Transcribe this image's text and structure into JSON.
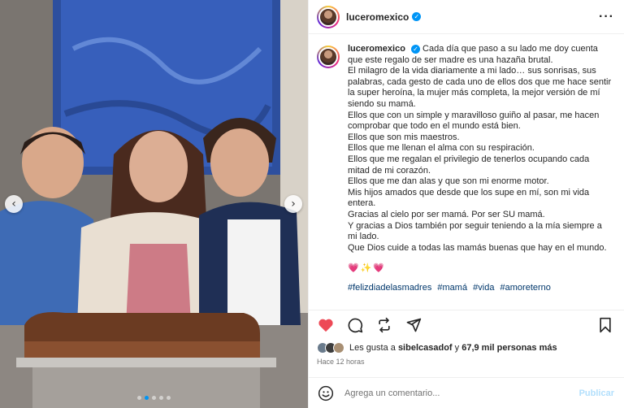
{
  "header": {
    "username": "luceromexico"
  },
  "caption": {
    "username": "luceromexico",
    "lines": [
      "Cada día que paso a su lado me doy cuenta que este regalo de ser madre es una hazaña brutal.",
      "El milagro de la vida diariamente a mi lado… sus sonrisas, sus palabras, cada gesto de cada uno de ellos dos que me hace sentir la super heroína, la mujer más completa, la mejor versión de mí siendo su mamá.",
      "Ellos que con un simple y maravilloso guiño al pasar, me hacen comprobar que todo en el mundo está bien.",
      "Ellos que son mis maestros.",
      "Ellos que me llenan el alma con su respiración.",
      "Ellos que me regalan el privilegio de tenerlos ocupando cada mitad de mi corazón.",
      "Ellos que me dan alas y que son mi enorme motor.",
      "Mis hijos amados que desde que los supe en mí, son mi vida entera.",
      "Gracias al cielo por ser mamá. Por ser SU mamá.",
      "Y gracias a Dios también por seguir teniendo a la mía siempre a mi lado.",
      "Que Dios cuide a todas las mamás buenas que hay en el mundo."
    ],
    "emojis": "💗✨💗",
    "hashtags": [
      "#felizdiadelasmadres",
      "#mamá",
      "#vida",
      "#amoreterno"
    ]
  },
  "likes": {
    "prefix": "Les gusta a",
    "user": "sibelcasadof",
    "joiner": "y",
    "others": "67,9 mil personas más"
  },
  "timestamp": "Hace 12 horas",
  "comment": {
    "placeholder": "Agrega un comentario...",
    "post_label": "Publicar"
  },
  "media": {
    "slide_count": 5,
    "active_slide": 2
  },
  "colors": {
    "accent": "#0095f6",
    "like_red": "#ed4956",
    "hashtag": "#00376b"
  }
}
